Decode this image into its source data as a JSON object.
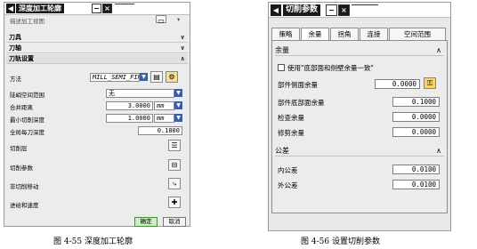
{
  "fig_a": {
    "title": "深度加工轮廓",
    "title_arrow": "◀",
    "minimize": "−",
    "close": "×",
    "header_fragment": "描述加工视图",
    "sections": [
      {
        "label": "刀具",
        "chev": "∨"
      },
      {
        "label": "刀轴",
        "chev": "∨"
      },
      {
        "label": "刀轨设置",
        "chev": "∧"
      }
    ],
    "rows": {
      "method_label": "方法",
      "method_value": "MILL_SEMI_FIN",
      "cut_region_label": "陡峭空间范围",
      "cut_region_value": "无",
      "merge_label": "合并距离",
      "merge_value": "3.0000",
      "merge_unit": "mm",
      "min_depth_label": "最小切削深度",
      "min_depth_value": "1.0000",
      "min_depth_unit": "mm",
      "depth_per_cut_label": "全局每刀深度",
      "depth_per_cut_value": "0.1800",
      "cut_levels_label": "切削层",
      "cut_params_label": "切削参数",
      "non_cutting_label": "非切削移动",
      "feeds_label": "进给和速度"
    },
    "buttons": {
      "ok": "确定",
      "cancel": "取消"
    },
    "caption": "图 4-55   深度加工轮廓"
  },
  "fig_b": {
    "title": "切削参数",
    "title_arrow": "◀",
    "minimize": "−",
    "close": "×",
    "tabs": [
      "策略",
      "余量",
      "拐角",
      "连接",
      "空间范围"
    ],
    "active_tab": 1,
    "stock_section": "余量",
    "chev_up": "∧",
    "use_floor_same": "使用\"底部面和侧壁余量一致\"",
    "side_stock_label": "部件侧面余量",
    "side_stock_value": "0.0000",
    "floor_stock_label": "部件底部面余量",
    "floor_stock_value": "0.1000",
    "check_stock_label": "检查余量",
    "check_stock_value": "0.0000",
    "trim_stock_label": "修剪余量",
    "trim_stock_value": "0.0000",
    "tolerance_section": "公差",
    "intol_label": "内公差",
    "intol_value": "0.0100",
    "outtol_label": "外公差",
    "outtol_value": "0.0100",
    "caption": "图 4-56   设置切削参数"
  }
}
